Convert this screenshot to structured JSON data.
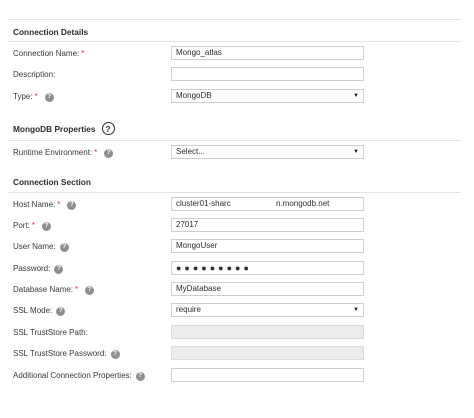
{
  "sections": {
    "connection_details": "Connection Details",
    "mongodb_properties": "MongoDB Properties",
    "connection_section": "Connection Section"
  },
  "icons": {
    "help": "question-circle-icon",
    "dropdown": "caret-down-icon"
  },
  "colors": {
    "required": "#e0342c",
    "help_icon": "#8f8f8f",
    "disabled_field": "#ececec"
  },
  "fields": {
    "connection_name": {
      "label": "Connection Name:",
      "value": "Mongo_atlas"
    },
    "description": {
      "label": "Description:",
      "value": ""
    },
    "type": {
      "label": "Type:",
      "value": "MongoDB"
    },
    "runtime_environment": {
      "label": "Runtime Environment:",
      "value": "Select..."
    },
    "host_name": {
      "label": "Host Name:",
      "value_part1": "cluster01-sharc",
      "value_part2": "n.mongodb.net"
    },
    "port": {
      "label": "Port:",
      "value": "27017"
    },
    "user_name": {
      "label": "User Name:",
      "value": "MongoUser"
    },
    "password": {
      "label": "Password:",
      "value": "●●●●●●●●●"
    },
    "database_name": {
      "label": "Database Name:",
      "value": "MyDatabase"
    },
    "ssl_mode": {
      "label": "SSL Mode:",
      "value": "require"
    },
    "ssl_truststore_path": {
      "label": "SSL TrustStore Path:",
      "value": ""
    },
    "ssl_truststore_password": {
      "label": "SSL TrustStore Password:",
      "value": ""
    },
    "additional_properties": {
      "label": "Additional Connection Properties:",
      "value": ""
    }
  }
}
